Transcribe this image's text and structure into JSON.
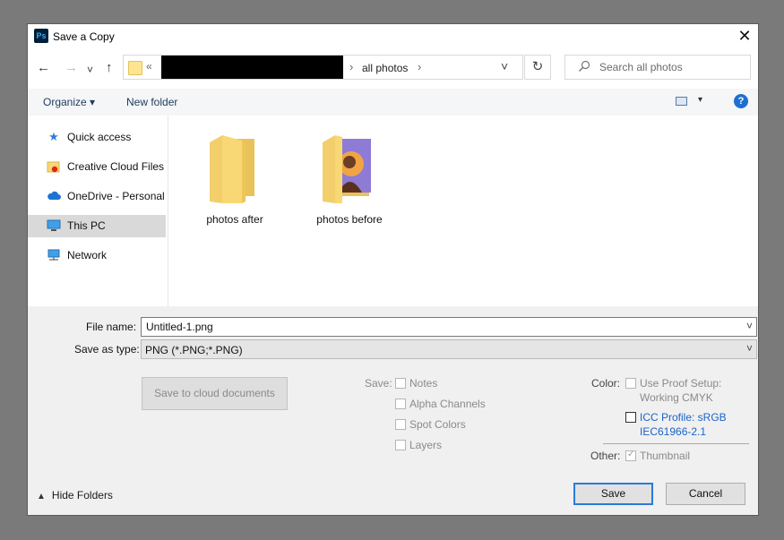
{
  "window": {
    "app_icon_text": "Ps",
    "title": "Save a Copy",
    "close_glyph": "✕"
  },
  "nav": {
    "back_glyph": "←",
    "forward_glyph": "→",
    "recent_glyph": "˅",
    "up_glyph": "↑",
    "address": {
      "overflow_glyph": "«",
      "crumb": "all photos",
      "separator_glyph": "›",
      "dropdown_glyph": "˅"
    },
    "refresh_glyph": "↻",
    "search": {
      "icon": "search-icon",
      "placeholder": "Search all photos"
    }
  },
  "toolbar": {
    "organize_label": "Organize ▾",
    "new_folder_label": "New folder",
    "view_dropdown_glyph": "▾",
    "help_glyph": "?"
  },
  "sidebar": {
    "items": [
      {
        "label": "Quick access",
        "icon": "star-icon",
        "selected": false
      },
      {
        "label": "Creative Cloud Files",
        "icon": "creative-cloud-folder-icon",
        "selected": false
      },
      {
        "label": "OneDrive - Personal",
        "icon": "cloud-icon",
        "selected": false
      },
      {
        "label": "This PC",
        "icon": "computer-icon",
        "selected": true
      },
      {
        "label": "Network",
        "icon": "network-icon",
        "selected": false
      }
    ]
  },
  "files": [
    {
      "name": "photos after",
      "icon": "folder-icon"
    },
    {
      "name": "photos before",
      "icon": "folder-with-photo-icon"
    }
  ],
  "form": {
    "file_name_label": "File name:",
    "file_name_value": "Untitled-1.png",
    "save_as_type_label": "Save as type:",
    "save_as_type_value": "PNG (*.PNG;*.PNG)",
    "dropdown_glyph": "˅",
    "cloud_button_label": "Save to cloud documents",
    "save_group_label": "Save:",
    "save_options": [
      {
        "label": "Notes",
        "checked": false
      },
      {
        "label": "Alpha Channels",
        "checked": false
      },
      {
        "label": "Spot Colors",
        "checked": false
      },
      {
        "label": "Layers",
        "checked": false
      }
    ],
    "color_label": "Color:",
    "use_proof_line1": "Use Proof Setup:",
    "use_proof_line2": "Working CMYK",
    "icc_line1": "ICC Profile:  sRGB",
    "icc_line2": "IEC61966-2.1",
    "other_label": "Other:",
    "thumbnail_label": "Thumbnail",
    "thumbnail_checked": true
  },
  "footer": {
    "hide_folders_caret": "▲",
    "hide_folders_label": "Hide Folders",
    "save_label": "Save",
    "cancel_label": "Cancel"
  },
  "colors": {
    "accent": "#2a7bd8",
    "link_blue": "#1a63c8",
    "ps_icon_bg": "#001e36",
    "ps_icon_fg": "#31a8ff",
    "folder_yellow": "#f8d775"
  }
}
